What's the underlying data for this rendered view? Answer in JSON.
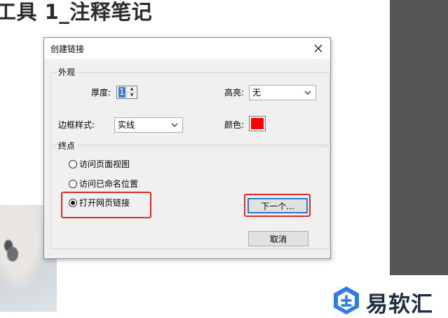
{
  "document": {
    "title": "工具 1_注释笔记"
  },
  "brand": {
    "text": "易软汇",
    "color": "#1b2b44",
    "icon": "brand-logo-icon"
  },
  "dialog": {
    "title": "创建链接",
    "close_icon": "close-icon",
    "appearance": {
      "label": "外观",
      "thickness_label": "厚度:",
      "thickness_value": "1",
      "highlight_label": "高亮:",
      "highlight_value": "无",
      "border_style_label": "边框样式:",
      "border_style_value": "实线",
      "color_label": "颜色:",
      "color_value": "#ff0000"
    },
    "endpoint": {
      "label": "终点",
      "options": [
        {
          "label": "访问页面视图",
          "selected": false
        },
        {
          "label": "访问已命名位置",
          "selected": false
        },
        {
          "label": "打开网页链接",
          "selected": true
        }
      ]
    },
    "next_button": "下一个...",
    "cancel_button": "取消",
    "highlight_color": "#e02a2a"
  }
}
